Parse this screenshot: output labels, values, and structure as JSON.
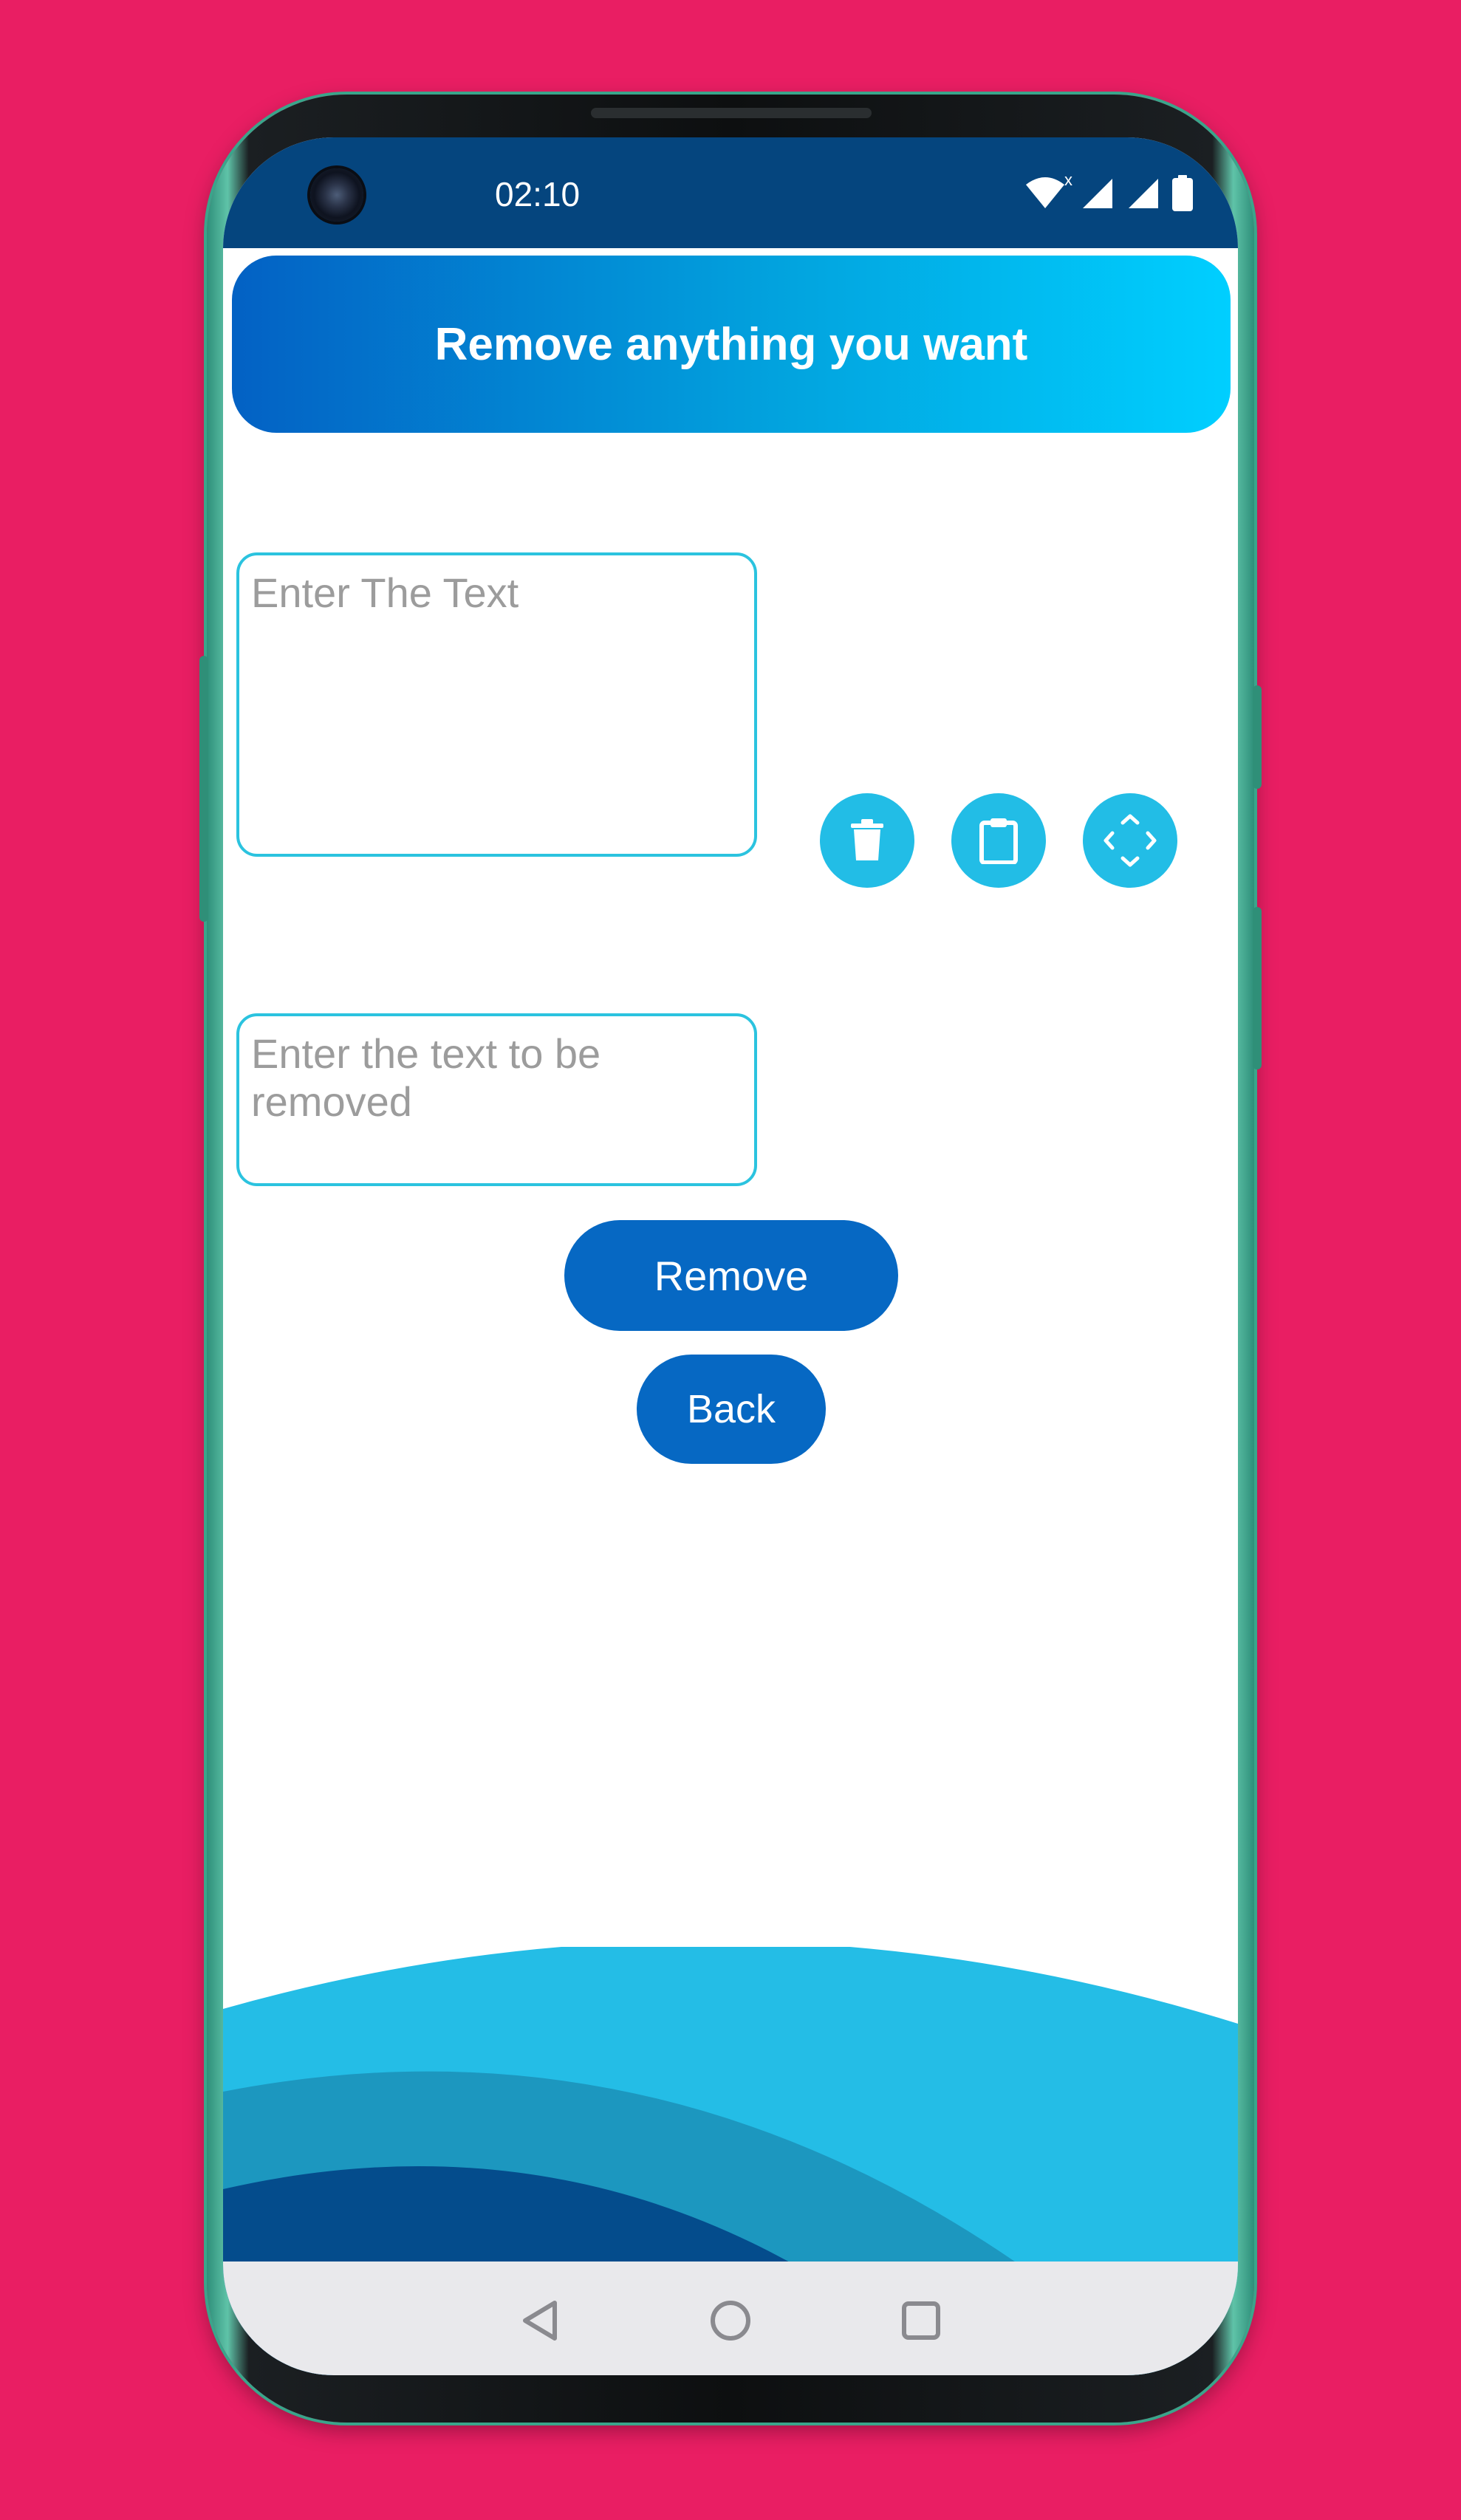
{
  "status_bar": {
    "time": "02:10"
  },
  "header": {
    "title": "Remove anything you want"
  },
  "main_input": {
    "placeholder": "Enter The Text",
    "value": ""
  },
  "actions": [
    {
      "icon": "trash-icon",
      "label": ""
    },
    {
      "icon": "clipboard-icon",
      "label": ""
    },
    {
      "icon": "expand-icon",
      "label": ""
    }
  ],
  "remove_input": {
    "placeholder": "Enter the text to be removed",
    "value": ""
  },
  "buttons": {
    "remove_label": "Remove",
    "back_label": "Back"
  },
  "nav_bar": {
    "back": "back-triangle-icon",
    "home": "home-circle-icon",
    "recents": "recents-square-icon"
  },
  "colors": {
    "background": "#e91e63",
    "status_bar": "#05457e",
    "header_start": "#0361c4",
    "header_end": "#00cfff",
    "field_border": "#2bc3df",
    "fab": "#22bde6",
    "primary_button": "#0668c3",
    "wave_light": "#24bde6",
    "wave_mid": "#1c97bf",
    "wave_dark": "#044c8c"
  }
}
